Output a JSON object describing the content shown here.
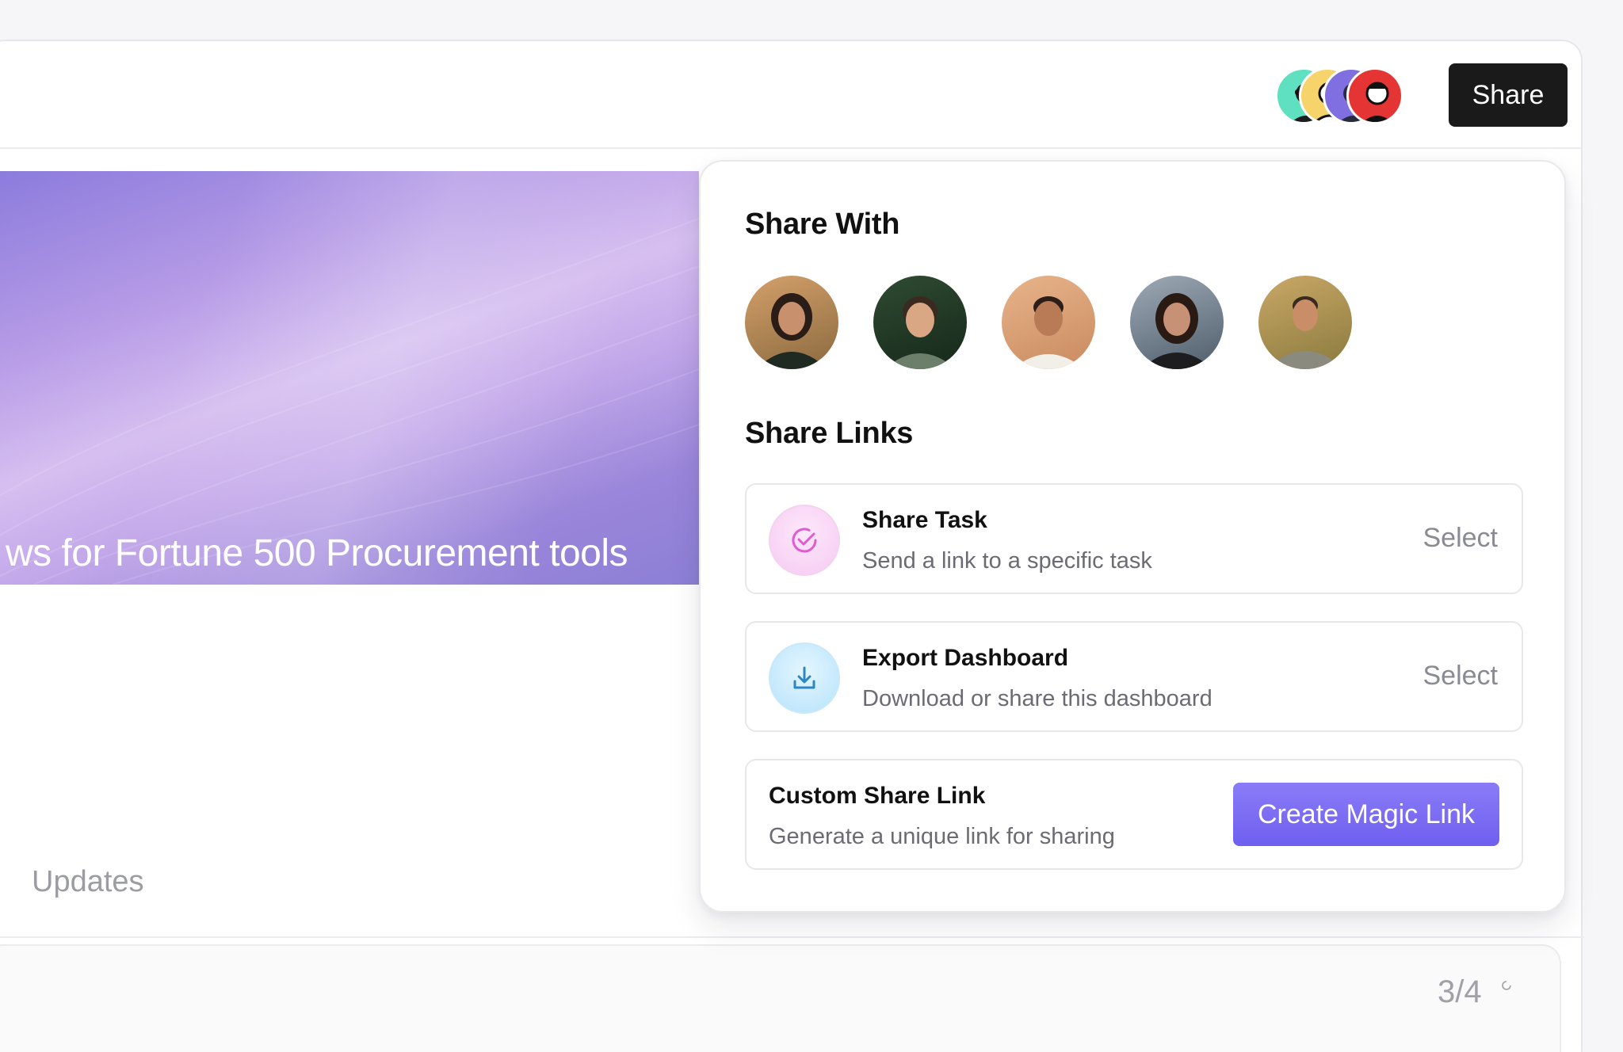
{
  "header": {
    "share_label": "Share"
  },
  "banner": {
    "title": "ws for Fortune 500 Procurement tools"
  },
  "tabs": {
    "updates_label": "Updates"
  },
  "footer": {
    "page_indicator": "3/4"
  },
  "popover": {
    "share_with_title": "Share With",
    "share_links_title": "Share Links",
    "options": [
      {
        "title": "Share Task",
        "subtitle": "Send a link to a specific task",
        "action": "Select",
        "icon": "check-circle-icon"
      },
      {
        "title": "Export Dashboard",
        "subtitle": "Download or share this dashboard",
        "action": "Select",
        "icon": "download-icon"
      }
    ],
    "custom": {
      "title": "Custom Share Link",
      "subtitle": "Generate a unique link for sharing",
      "button_label": "Create Magic Link"
    }
  },
  "colors": {
    "accent": "#7467f2",
    "share_button_bg": "#1a1a1a",
    "task_icon": "#e05bd0",
    "export_icon": "#2d87c4"
  }
}
